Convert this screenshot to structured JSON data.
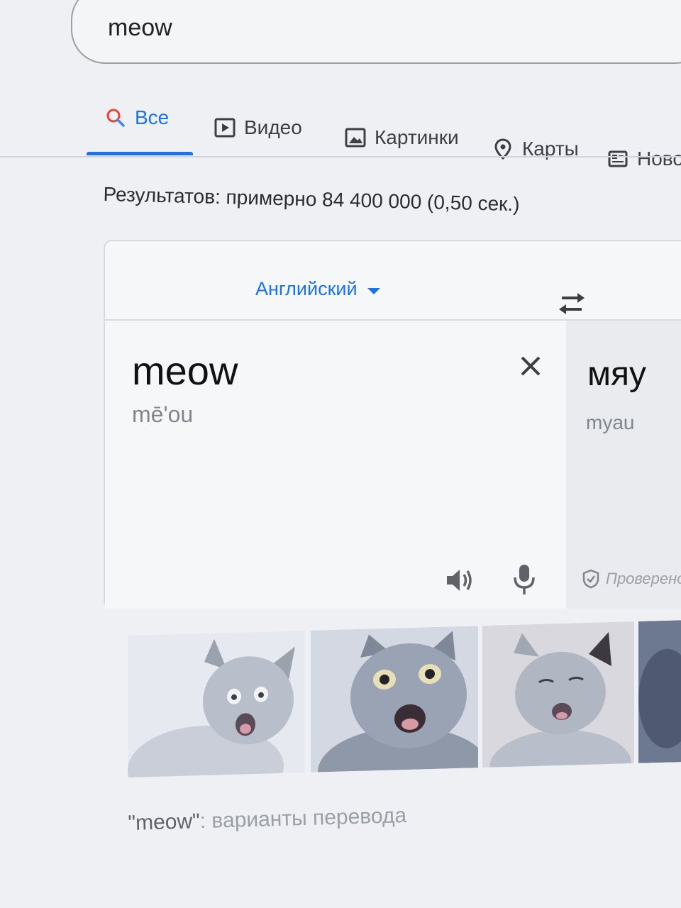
{
  "search": {
    "query": "meow"
  },
  "tabs": [
    {
      "label": "Все",
      "icon": "search-icon",
      "active": true
    },
    {
      "label": "Видео",
      "icon": "video-icon"
    },
    {
      "label": "Картинки",
      "icon": "image-icon"
    },
    {
      "label": "Карты",
      "icon": "map-pin-icon"
    },
    {
      "label": "Новос",
      "icon": "news-icon"
    }
  ],
  "stats": "Результатов: примерно 84 400 000 (0,50 сек.)",
  "translate": {
    "source_language": "Английский",
    "source_text": "meow",
    "source_transliteration": "mē'ou",
    "target_text": "мяу",
    "target_transliteration": "myau",
    "verified_label": "Проверено"
  },
  "images": [
    {
      "subject": "kitten-meowing"
    },
    {
      "subject": "gray-cat-meowing"
    },
    {
      "subject": "tabby-kitten-meowing"
    },
    {
      "subject": "cat-partial"
    }
  ],
  "variants": {
    "quoted_word": "\"meow\"",
    "label": ": варианты перевода"
  },
  "colors": {
    "accent": "#1a73e8",
    "text": "#202124",
    "muted": "#80868b"
  }
}
